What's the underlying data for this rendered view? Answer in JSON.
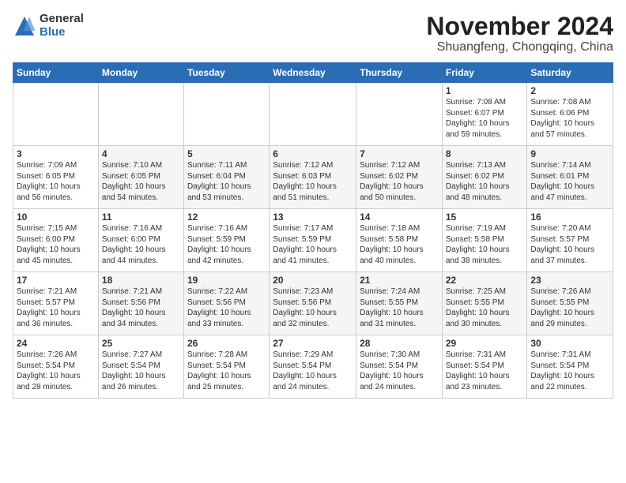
{
  "logo": {
    "general": "General",
    "blue": "Blue"
  },
  "title": "November 2024",
  "subtitle": "Shuangfeng, Chongqing, China",
  "days_of_week": [
    "Sunday",
    "Monday",
    "Tuesday",
    "Wednesday",
    "Thursday",
    "Friday",
    "Saturday"
  ],
  "weeks": [
    [
      {
        "day": "",
        "info": ""
      },
      {
        "day": "",
        "info": ""
      },
      {
        "day": "",
        "info": ""
      },
      {
        "day": "",
        "info": ""
      },
      {
        "day": "",
        "info": ""
      },
      {
        "day": "1",
        "info": "Sunrise: 7:08 AM\nSunset: 6:07 PM\nDaylight: 10 hours\nand 59 minutes."
      },
      {
        "day": "2",
        "info": "Sunrise: 7:08 AM\nSunset: 6:06 PM\nDaylight: 10 hours\nand 57 minutes."
      }
    ],
    [
      {
        "day": "3",
        "info": "Sunrise: 7:09 AM\nSunset: 6:05 PM\nDaylight: 10 hours\nand 56 minutes."
      },
      {
        "day": "4",
        "info": "Sunrise: 7:10 AM\nSunset: 6:05 PM\nDaylight: 10 hours\nand 54 minutes."
      },
      {
        "day": "5",
        "info": "Sunrise: 7:11 AM\nSunset: 6:04 PM\nDaylight: 10 hours\nand 53 minutes."
      },
      {
        "day": "6",
        "info": "Sunrise: 7:12 AM\nSunset: 6:03 PM\nDaylight: 10 hours\nand 51 minutes."
      },
      {
        "day": "7",
        "info": "Sunrise: 7:12 AM\nSunset: 6:02 PM\nDaylight: 10 hours\nand 50 minutes."
      },
      {
        "day": "8",
        "info": "Sunrise: 7:13 AM\nSunset: 6:02 PM\nDaylight: 10 hours\nand 48 minutes."
      },
      {
        "day": "9",
        "info": "Sunrise: 7:14 AM\nSunset: 6:01 PM\nDaylight: 10 hours\nand 47 minutes."
      }
    ],
    [
      {
        "day": "10",
        "info": "Sunrise: 7:15 AM\nSunset: 6:00 PM\nDaylight: 10 hours\nand 45 minutes."
      },
      {
        "day": "11",
        "info": "Sunrise: 7:16 AM\nSunset: 6:00 PM\nDaylight: 10 hours\nand 44 minutes."
      },
      {
        "day": "12",
        "info": "Sunrise: 7:16 AM\nSunset: 5:59 PM\nDaylight: 10 hours\nand 42 minutes."
      },
      {
        "day": "13",
        "info": "Sunrise: 7:17 AM\nSunset: 5:59 PM\nDaylight: 10 hours\nand 41 minutes."
      },
      {
        "day": "14",
        "info": "Sunrise: 7:18 AM\nSunset: 5:58 PM\nDaylight: 10 hours\nand 40 minutes."
      },
      {
        "day": "15",
        "info": "Sunrise: 7:19 AM\nSunset: 5:58 PM\nDaylight: 10 hours\nand 38 minutes."
      },
      {
        "day": "16",
        "info": "Sunrise: 7:20 AM\nSunset: 5:57 PM\nDaylight: 10 hours\nand 37 minutes."
      }
    ],
    [
      {
        "day": "17",
        "info": "Sunrise: 7:21 AM\nSunset: 5:57 PM\nDaylight: 10 hours\nand 36 minutes."
      },
      {
        "day": "18",
        "info": "Sunrise: 7:21 AM\nSunset: 5:56 PM\nDaylight: 10 hours\nand 34 minutes."
      },
      {
        "day": "19",
        "info": "Sunrise: 7:22 AM\nSunset: 5:56 PM\nDaylight: 10 hours\nand 33 minutes."
      },
      {
        "day": "20",
        "info": "Sunrise: 7:23 AM\nSunset: 5:56 PM\nDaylight: 10 hours\nand 32 minutes."
      },
      {
        "day": "21",
        "info": "Sunrise: 7:24 AM\nSunset: 5:55 PM\nDaylight: 10 hours\nand 31 minutes."
      },
      {
        "day": "22",
        "info": "Sunrise: 7:25 AM\nSunset: 5:55 PM\nDaylight: 10 hours\nand 30 minutes."
      },
      {
        "day": "23",
        "info": "Sunrise: 7:26 AM\nSunset: 5:55 PM\nDaylight: 10 hours\nand 29 minutes."
      }
    ],
    [
      {
        "day": "24",
        "info": "Sunrise: 7:26 AM\nSunset: 5:54 PM\nDaylight: 10 hours\nand 28 minutes."
      },
      {
        "day": "25",
        "info": "Sunrise: 7:27 AM\nSunset: 5:54 PM\nDaylight: 10 hours\nand 26 minutes."
      },
      {
        "day": "26",
        "info": "Sunrise: 7:28 AM\nSunset: 5:54 PM\nDaylight: 10 hours\nand 25 minutes."
      },
      {
        "day": "27",
        "info": "Sunrise: 7:29 AM\nSunset: 5:54 PM\nDaylight: 10 hours\nand 24 minutes."
      },
      {
        "day": "28",
        "info": "Sunrise: 7:30 AM\nSunset: 5:54 PM\nDaylight: 10 hours\nand 24 minutes."
      },
      {
        "day": "29",
        "info": "Sunrise: 7:31 AM\nSunset: 5:54 PM\nDaylight: 10 hours\nand 23 minutes."
      },
      {
        "day": "30",
        "info": "Sunrise: 7:31 AM\nSunset: 5:54 PM\nDaylight: 10 hours\nand 22 minutes."
      }
    ]
  ]
}
